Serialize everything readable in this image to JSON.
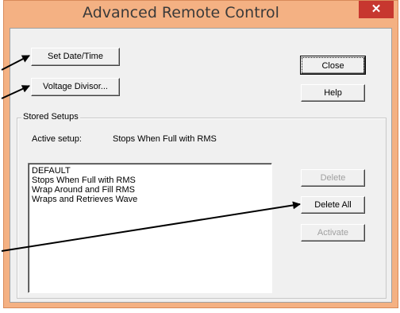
{
  "window": {
    "title": "Advanced Remote Control",
    "close_glyph": "✕"
  },
  "buttons": {
    "set_date_time": "Set Date/Time",
    "voltage_divisor": "Voltage Divisor...",
    "close": "Close",
    "help": "Help",
    "delete": "Delete",
    "delete_all": "Delete All",
    "activate": "Activate"
  },
  "stored_setups": {
    "group_label": "Stored Setups",
    "active_label": "Active setup:",
    "active_value": "Stops When Full with RMS",
    "items": [
      "DEFAULT",
      "Stops When Full with RMS",
      "Wrap Around and Fill RMS",
      "Wraps and Retrieves Wave"
    ]
  },
  "colors": {
    "frame": "#f4b183",
    "dialog_bg": "#f0f0f0",
    "close_red": "#c7372f",
    "disabled_text": "#a0a0a0"
  },
  "icons": [
    "close-icon",
    "callout-arrow"
  ]
}
